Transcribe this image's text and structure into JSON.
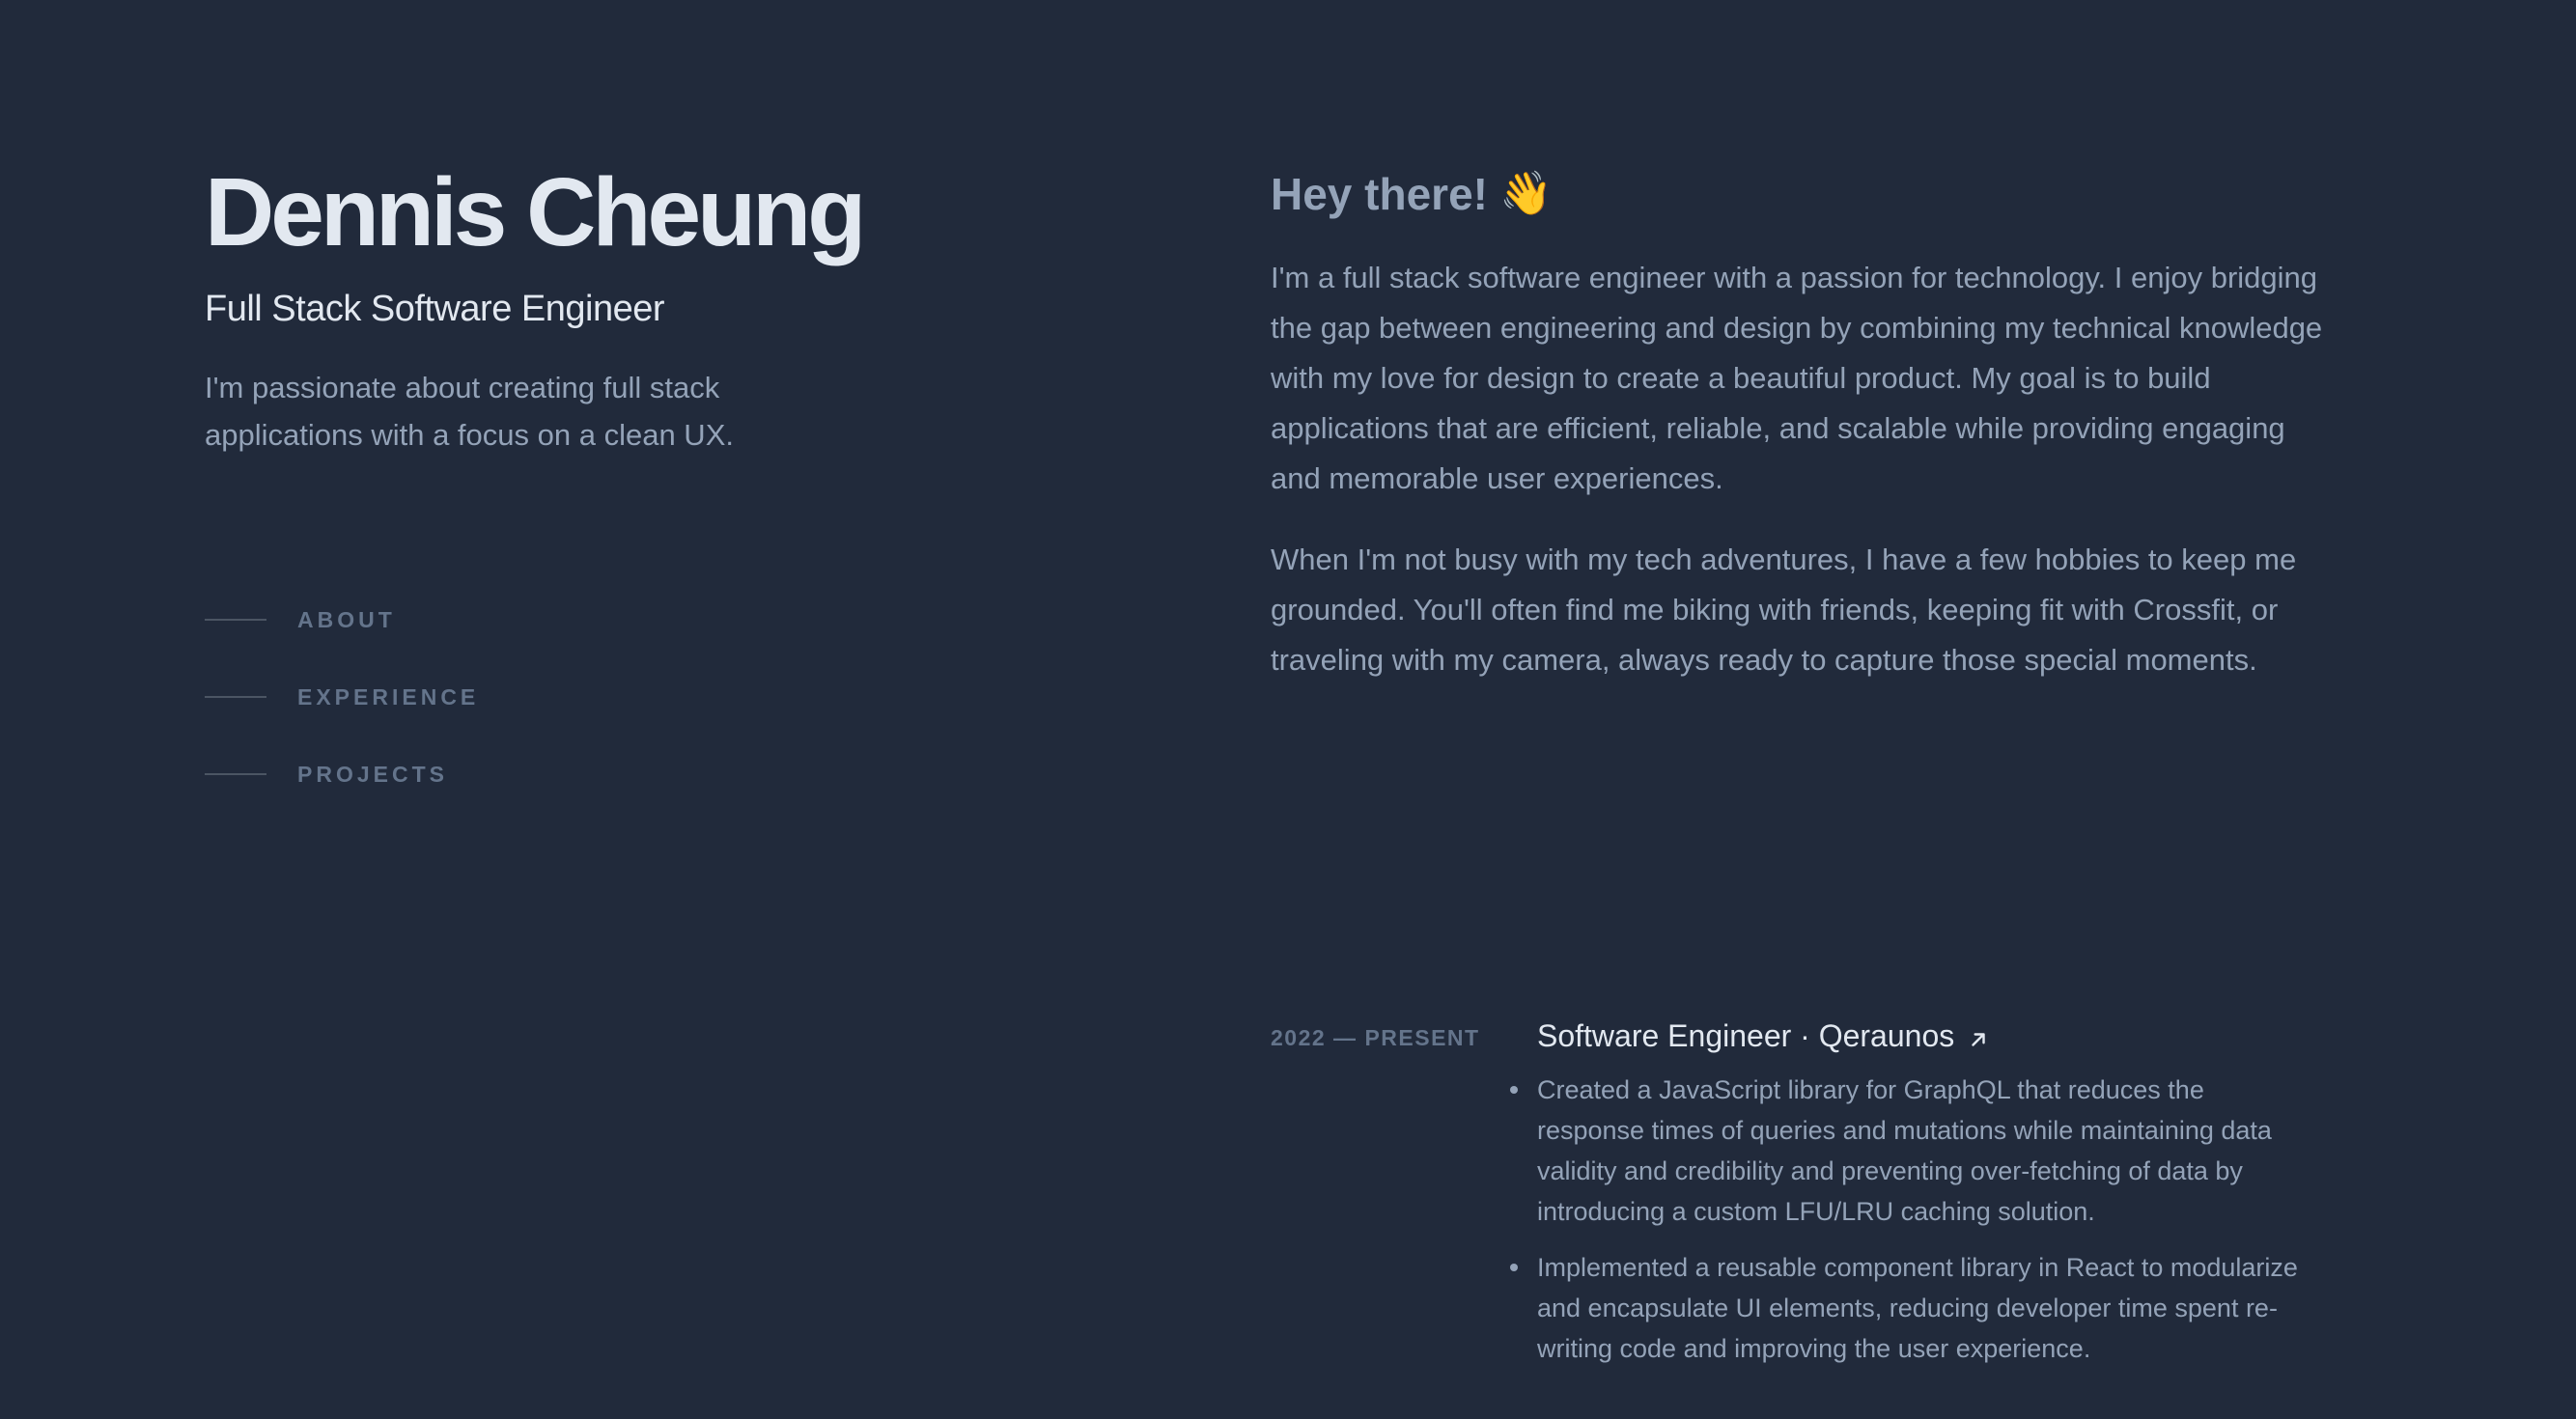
{
  "header": {
    "name": "Dennis Cheung",
    "role": "Full Stack Software Engineer",
    "tagline": "I'm passionate about creating full stack applications with a focus on a clean UX."
  },
  "nav": {
    "items": [
      {
        "label": "ABOUT"
      },
      {
        "label": "EXPERIENCE"
      },
      {
        "label": "PROJECTS"
      }
    ]
  },
  "about": {
    "greeting": "Hey there!",
    "greeting_icon": "waving-hand-icon",
    "paragraphs": [
      "I'm a full stack software engineer with a passion for technology. I enjoy bridging the gap between engineering and design by combining my technical knowledge with my love for design to create a beautiful product. My goal is to build applications that are efficient, reliable, and scalable while providing engaging and memorable user experiences.",
      "When I'm not busy with my tech adventures, I have a few hobbies to keep me grounded. You'll often find me biking with friends, keeping fit with Crossfit, or traveling with my camera, always ready to capture those special moments."
    ]
  },
  "experience": [
    {
      "date": "2022 — PRESENT",
      "title": "Software Engineer · Qeraunos",
      "link_icon": "arrow-up-right-icon",
      "bullets": [
        "Created a JavaScript library for GraphQL that reduces the response times of queries and mutations while maintaining data validity and credibility and preventing over-fetching of data by introducing a custom LFU/LRU caching solution.",
        "Implemented a reusable component library in React to modularize and encapsulate UI elements, reducing developer time spent re-writing code and improving the user experience."
      ]
    }
  ],
  "colors": {
    "background": "#212a3b",
    "heading": "#e2e8f0",
    "body": "#94a3b8",
    "muted": "#64748b"
  }
}
